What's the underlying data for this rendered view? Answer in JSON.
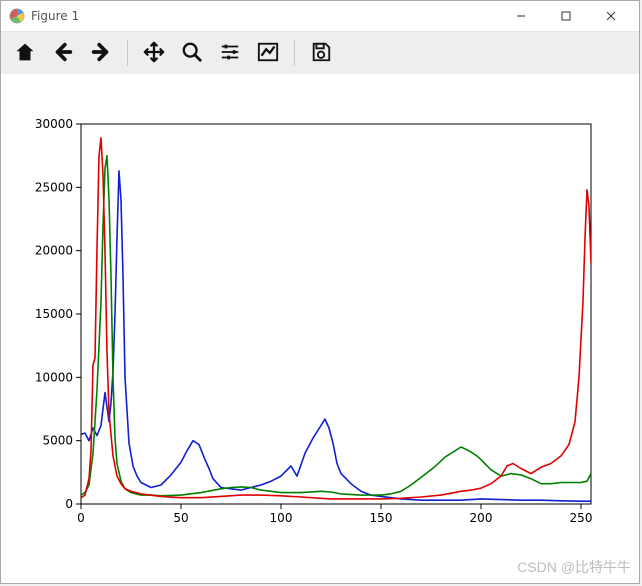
{
  "window": {
    "title": "Figure 1"
  },
  "toolbar": {
    "home": "Home",
    "back": "Back",
    "forward": "Forward",
    "pan": "Pan",
    "zoom": "Zoom",
    "subplots": "Configure subplots",
    "edit": "Edit axis",
    "save": "Save"
  },
  "watermark": "CSDN @比特牛牛",
  "chart_data": {
    "type": "line",
    "xlabel": "",
    "ylabel": "",
    "xlim": [
      0,
      255
    ],
    "ylim": [
      0,
      30000
    ],
    "x_ticks": [
      0,
      50,
      100,
      150,
      200,
      250
    ],
    "y_ticks": [
      0,
      5000,
      10000,
      15000,
      20000,
      25000,
      30000
    ],
    "colors": {
      "blue": "#1020d0",
      "green": "#008000",
      "red": "#e00000"
    },
    "series": [
      {
        "name": "blue",
        "color": "#1020d0",
        "x": [
          0,
          2,
          4,
          6,
          8,
          10,
          12,
          14,
          15,
          16,
          17,
          18,
          19,
          20,
          21,
          22,
          24,
          26,
          28,
          30,
          35,
          40,
          45,
          50,
          53,
          56,
          59,
          62,
          64,
          66,
          70,
          75,
          80,
          85,
          90,
          95,
          100,
          105,
          108,
          112,
          116,
          120,
          122,
          124,
          126,
          128,
          130,
          135,
          140,
          145,
          150,
          160,
          170,
          180,
          190,
          200,
          210,
          220,
          230,
          240,
          250,
          254,
          255
        ],
        "values": [
          5500,
          5600,
          5000,
          6000,
          5400,
          6200,
          8800,
          6500,
          8000,
          10500,
          15000,
          21000,
          26300,
          24000,
          18000,
          10000,
          4800,
          3000,
          2200,
          1700,
          1300,
          1500,
          2300,
          3300,
          4200,
          5000,
          4700,
          3500,
          2800,
          2000,
          1300,
          1200,
          1100,
          1300,
          1500,
          1800,
          2200,
          3000,
          2200,
          4000,
          5200,
          6200,
          6700,
          6000,
          4800,
          3200,
          2400,
          1600,
          1000,
          700,
          600,
          400,
          300,
          300,
          300,
          400,
          350,
          300,
          300,
          250,
          220,
          220,
          220
        ]
      },
      {
        "name": "green",
        "color": "#008000",
        "x": [
          0,
          2,
          4,
          6,
          8,
          10,
          11,
          12,
          13,
          14,
          15,
          16,
          17,
          18,
          20,
          22,
          25,
          30,
          35,
          40,
          50,
          60,
          65,
          70,
          75,
          80,
          85,
          90,
          100,
          110,
          120,
          125,
          130,
          140,
          150,
          155,
          160,
          165,
          170,
          175,
          178,
          182,
          186,
          190,
          194,
          198,
          200,
          205,
          210,
          215,
          220,
          225,
          230,
          235,
          240,
          245,
          250,
          253,
          254,
          255
        ],
        "values": [
          700,
          900,
          1500,
          4000,
          9000,
          16000,
          22000,
          26500,
          27500,
          24000,
          18000,
          10000,
          5200,
          3200,
          1800,
          1200,
          900,
          700,
          700,
          650,
          700,
          900,
          1050,
          1200,
          1300,
          1350,
          1300,
          1100,
          900,
          900,
          1000,
          950,
          800,
          700,
          700,
          800,
          1000,
          1500,
          2100,
          2700,
          3100,
          3700,
          4100,
          4500,
          4200,
          3800,
          3500,
          2700,
          2200,
          2400,
          2300,
          2000,
          1600,
          1600,
          1700,
          1700,
          1700,
          1800,
          2100,
          2400
        ]
      },
      {
        "name": "red",
        "color": "#e00000",
        "x": [
          0,
          2,
          4,
          5,
          6,
          7,
          8,
          9,
          10,
          11,
          12,
          13,
          14,
          16,
          18,
          20,
          22,
          25,
          30,
          40,
          50,
          60,
          70,
          80,
          90,
          100,
          110,
          120,
          125,
          130,
          140,
          150,
          160,
          170,
          180,
          185,
          190,
          195,
          200,
          205,
          210,
          213,
          216,
          220,
          225,
          230,
          235,
          240,
          244,
          247,
          249,
          251,
          252,
          253,
          254,
          255
        ],
        "values": [
          500,
          700,
          2000,
          4200,
          11000,
          11500,
          20200,
          27500,
          28900,
          26000,
          20000,
          12000,
          7200,
          3800,
          2200,
          1600,
          1200,
          1000,
          800,
          600,
          500,
          500,
          600,
          700,
          700,
          650,
          550,
          450,
          400,
          400,
          400,
          400,
          450,
          550,
          700,
          850,
          1000,
          1100,
          1250,
          1600,
          2200,
          3000,
          3200,
          2800,
          2400,
          2900,
          3200,
          3800,
          4700,
          6500,
          10000,
          16000,
          21000,
          24800,
          23500,
          19000
        ]
      }
    ]
  }
}
